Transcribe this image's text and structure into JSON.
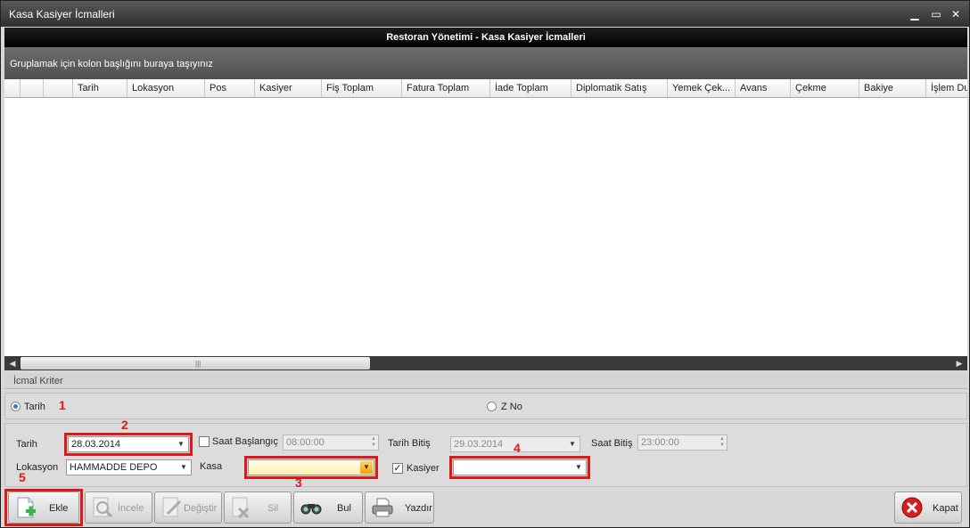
{
  "window": {
    "title": "Kasa Kasiyer İcmalleri",
    "minimize": "▁",
    "maximize": "▭",
    "close": "✕"
  },
  "header": {
    "title": "Restoran Yönetimi - Kasa Kasiyer İcmalleri"
  },
  "grid": {
    "group_hint": "Gruplamak için kolon başlığını buraya taşıyınız",
    "columns": [
      "Tarih",
      "Lokasyon",
      "Pos",
      "Kasiyer",
      "Fiş Toplam",
      "Fatura Toplam",
      "İade Toplam",
      "Diplomatik Satış",
      "Yemek Çek...",
      "Avans",
      "Çekme",
      "Bakiye",
      "İşlem Du"
    ],
    "rows": []
  },
  "criteria": {
    "title": "İcmal Kriter",
    "radio_tarih": "Tarih",
    "radio_zno": "Z No",
    "selected": "Tarih"
  },
  "form": {
    "tarih_label": "Tarih",
    "tarih_value": "28.03.2014",
    "saat_baslangic_label": "Saat Başlangıç",
    "saat_baslangic_value": "08:00:00",
    "saat_baslangic_checked": false,
    "tarih_bitis_label": "Tarih Bitiş",
    "tarih_bitis_value": "29.03.2014",
    "saat_bitis_label": "Saat Bitiş",
    "saat_bitis_value": "23:00:00",
    "lokasyon_label": "Lokasyon",
    "lokasyon_value": "HAMMADDE DEPO",
    "kasa_label": "Kasa",
    "kasa_value": "",
    "kasiyer_label": "Kasiyer",
    "kasiyer_checked": true,
    "kasiyer_value": ""
  },
  "annotations": {
    "n1": "1",
    "n2": "2",
    "n3": "3",
    "n4": "4",
    "n5": "5",
    "color": "#e01818"
  },
  "toolbar": {
    "ekle": "Ekle",
    "incele": "İncele",
    "degistir": "Değiştir",
    "sil": "Sil",
    "bul": "Bul",
    "yazdir": "Yazdır",
    "kapat": "Kapat"
  },
  "scroll": {
    "left_arrow": "◀",
    "right_arrow": "▶",
    "grip": "|||"
  },
  "colors": {
    "accent_red": "#e01818",
    "yellow_highlight": "#fff2b0",
    "dark_header": "#000000"
  }
}
